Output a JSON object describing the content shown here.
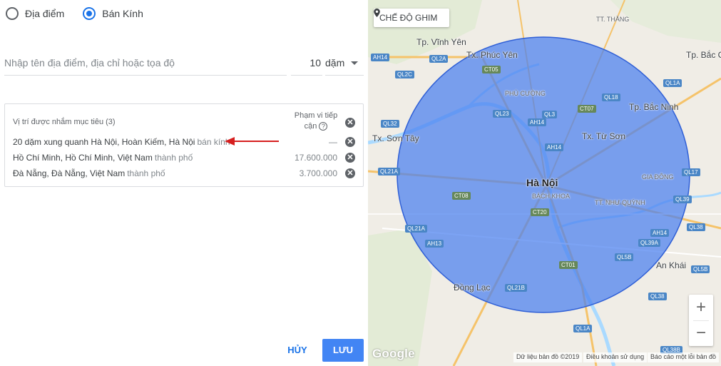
{
  "mode": {
    "options": [
      {
        "label": "Địa điểm",
        "selected": false
      },
      {
        "label": "Bán Kính",
        "selected": true
      }
    ]
  },
  "search": {
    "placeholder": "Nhập tên địa điểm, địa chỉ hoặc tọa độ",
    "value": "",
    "radius": "10",
    "unit": "dặm"
  },
  "targets": {
    "header": "Vị trí được nhắm mục tiêu (3)",
    "reach_header": "Phạm vi tiếp cận",
    "help_icon": "?",
    "remove_icon": "✕",
    "items": [
      {
        "name": "20 dặm xung quanh Hà Nội, Hoàn Kiếm, Hà Nội",
        "type": "bán kính",
        "reach": "—"
      },
      {
        "name": "Hồ Chí Minh, Hồ Chí Minh, Việt Nam",
        "type": "thành phố",
        "reach": "17.600.000"
      },
      {
        "name": "Đà Nẵng, Đà Nẵng, Việt Nam",
        "type": "thành phố",
        "reach": "3.700.000"
      }
    ]
  },
  "actions": {
    "cancel": "HỦY",
    "save": "LƯU"
  },
  "map": {
    "pin_mode": "CHẾ ĐỘ GHIM",
    "zoom_in": "+",
    "zoom_out": "−",
    "logo": "Google",
    "attribution": {
      "data": "Dữ liệu bản đồ ©2019",
      "terms": "Điều khoản sử dụng",
      "report": "Báo cáo một lỗi bản đồ"
    },
    "places": {
      "hanoi": "Hà Nội",
      "bachkhoa": "BÁCH KHOA",
      "vinhyen": "Tp. Vĩnh Yên",
      "phucyen": "Tx. Phúc Yên",
      "phucuong": "PHÙ CƯỜNG",
      "tuson": "Tx. Từ Sơn",
      "bacninh": "Tp. Bắc Ninh",
      "bacg": "Tp. Bắc G",
      "sontay": "Tx. Sơn Tây",
      "donglac": "Đồng Lạc",
      "giadong": "GIA ĐÔNG",
      "nhuquynh": "TT. NHƯ QUỲNH",
      "ankhai": "An Khái",
      "ttthang": "TT. THẮNG"
    },
    "roads": {
      "ah14a": "AH14",
      "ql2a": "QL2A",
      "ql2c": "QL2C",
      "ct05": "CT05",
      "ql1a_top": "QL1A",
      "ql18": "QL18",
      "ql23": "QL23",
      "ql3": "QL3",
      "ct07": "CT07",
      "ql32": "QL32",
      "ah14b": "AH14",
      "ah14c": "AH14",
      "ql21a": "QL21A",
      "ql17": "QL17",
      "ct08": "CT08",
      "ct20": "CT20",
      "ql39": "QL39",
      "ql21a_b": "QL21A",
      "ah13": "AH13",
      "ah14d": "AH14",
      "ql38": "QL38",
      "ql39a": "QL39A",
      "ql5b": "QL5B",
      "ql5b_r": "QL5B",
      "ct01": "CT01",
      "ql21b": "QL21B",
      "ql38_b": "QL38",
      "ql1a_bot": "QL1A",
      "ql38b": "QL38B"
    }
  }
}
